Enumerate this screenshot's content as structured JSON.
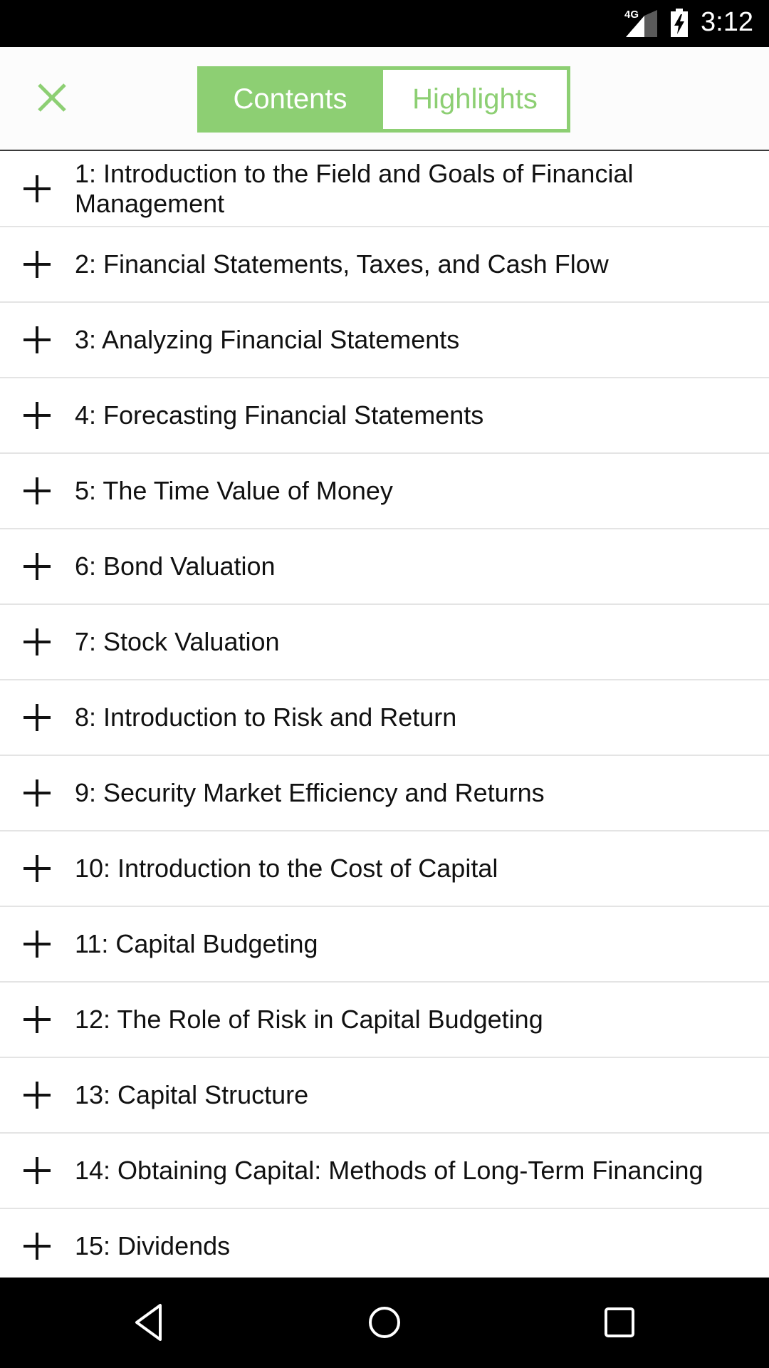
{
  "status_bar": {
    "network": "4G",
    "time": "3:12",
    "icons": [
      "network-4g-icon",
      "signal-icon",
      "battery-charging-icon"
    ]
  },
  "header": {
    "close_icon": "close-icon",
    "colors": {
      "accent": "#8dcf73",
      "text": "#111111",
      "divider": "#e4e4e4"
    },
    "tabs": [
      {
        "label": "Contents",
        "selected": true
      },
      {
        "label": "Highlights",
        "selected": false
      }
    ]
  },
  "toc": {
    "expand_icon": "plus-icon",
    "items": [
      {
        "label": "1: Introduction to the Field and Goals of Financial Management"
      },
      {
        "label": "2: Financial Statements, Taxes, and Cash Flow"
      },
      {
        "label": "3: Analyzing Financial Statements"
      },
      {
        "label": "4: Forecasting Financial Statements"
      },
      {
        "label": "5: The Time Value of Money"
      },
      {
        "label": "6: Bond Valuation"
      },
      {
        "label": "7: Stock Valuation"
      },
      {
        "label": "8: Introduction to Risk and Return"
      },
      {
        "label": "9: Security Market Efficiency and Returns"
      },
      {
        "label": "10: Introduction to the Cost of Capital"
      },
      {
        "label": "11: Capital Budgeting"
      },
      {
        "label": "12: The Role of Risk in Capital Budgeting"
      },
      {
        "label": "13: Capital Structure"
      },
      {
        "label": "14: Obtaining Capital: Methods of Long-Term Financing"
      },
      {
        "label": "15: Dividends"
      }
    ]
  },
  "nav_bar": {
    "buttons": [
      "back-icon",
      "home-icon",
      "recents-icon"
    ]
  }
}
